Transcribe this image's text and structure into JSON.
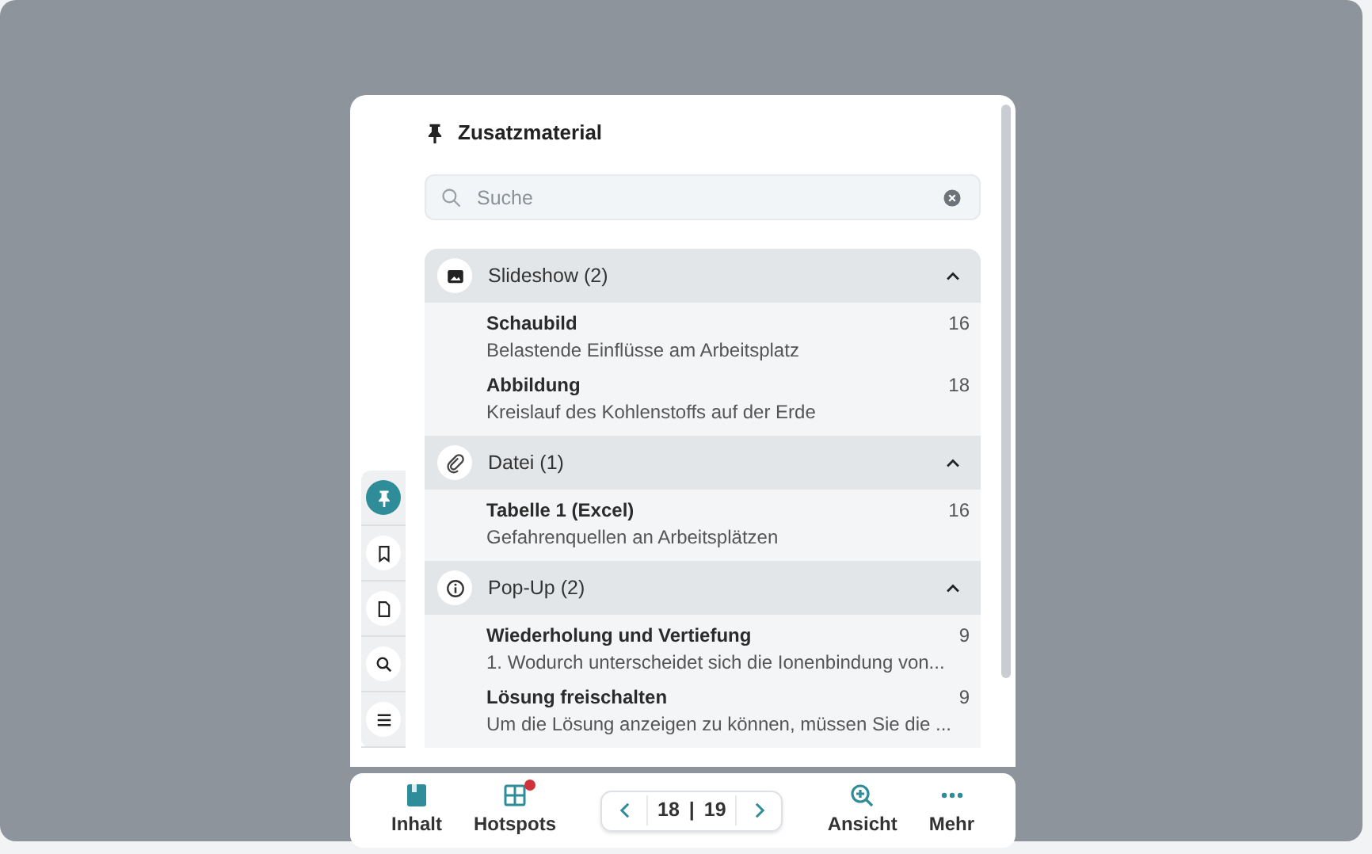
{
  "panel": {
    "title": "Zusatzmaterial",
    "search": {
      "placeholder": "Suche"
    },
    "sections": [
      {
        "title": "Slideshow (2)",
        "expanded": true,
        "items": [
          {
            "title": "Schaubild",
            "description": "Belastende Einflüsse am Arbeitsplatz",
            "page": "16"
          },
          {
            "title": "Abbildung",
            "description": "Kreislauf des Kohlenstoffs auf der Erde",
            "page": "18"
          }
        ]
      },
      {
        "title": "Datei (1)",
        "expanded": true,
        "items": [
          {
            "title": "Tabelle 1 (Excel)",
            "description": "Gefahrenquellen an Arbeitsplätzen",
            "page": "16"
          }
        ]
      },
      {
        "title": "Pop-Up (2)",
        "expanded": true,
        "items": [
          {
            "title": "Wiederholung und Vertiefung",
            "description": "1. Wodurch unterscheidet sich die Ionenbindung von...",
            "page": "9"
          },
          {
            "title": "Lösung freischalten",
            "description": "Um die Lösung anzeigen zu können, müssen Sie die ...",
            "page": "9"
          }
        ]
      }
    ]
  },
  "side_rail": [
    {
      "selected": true
    },
    {
      "selected": false
    },
    {
      "selected": false
    },
    {
      "selected": false
    },
    {
      "selected": false
    }
  ],
  "toolbar": {
    "left": [
      {
        "label": "Inhalt",
        "notification": false
      },
      {
        "label": "Hotspots",
        "notification": true
      }
    ],
    "pager": {
      "current": "18",
      "separator": "|",
      "total": "19"
    },
    "right": [
      {
        "label": "Ansicht",
        "notification": false
      },
      {
        "label": "Mehr",
        "notification": false
      }
    ]
  }
}
